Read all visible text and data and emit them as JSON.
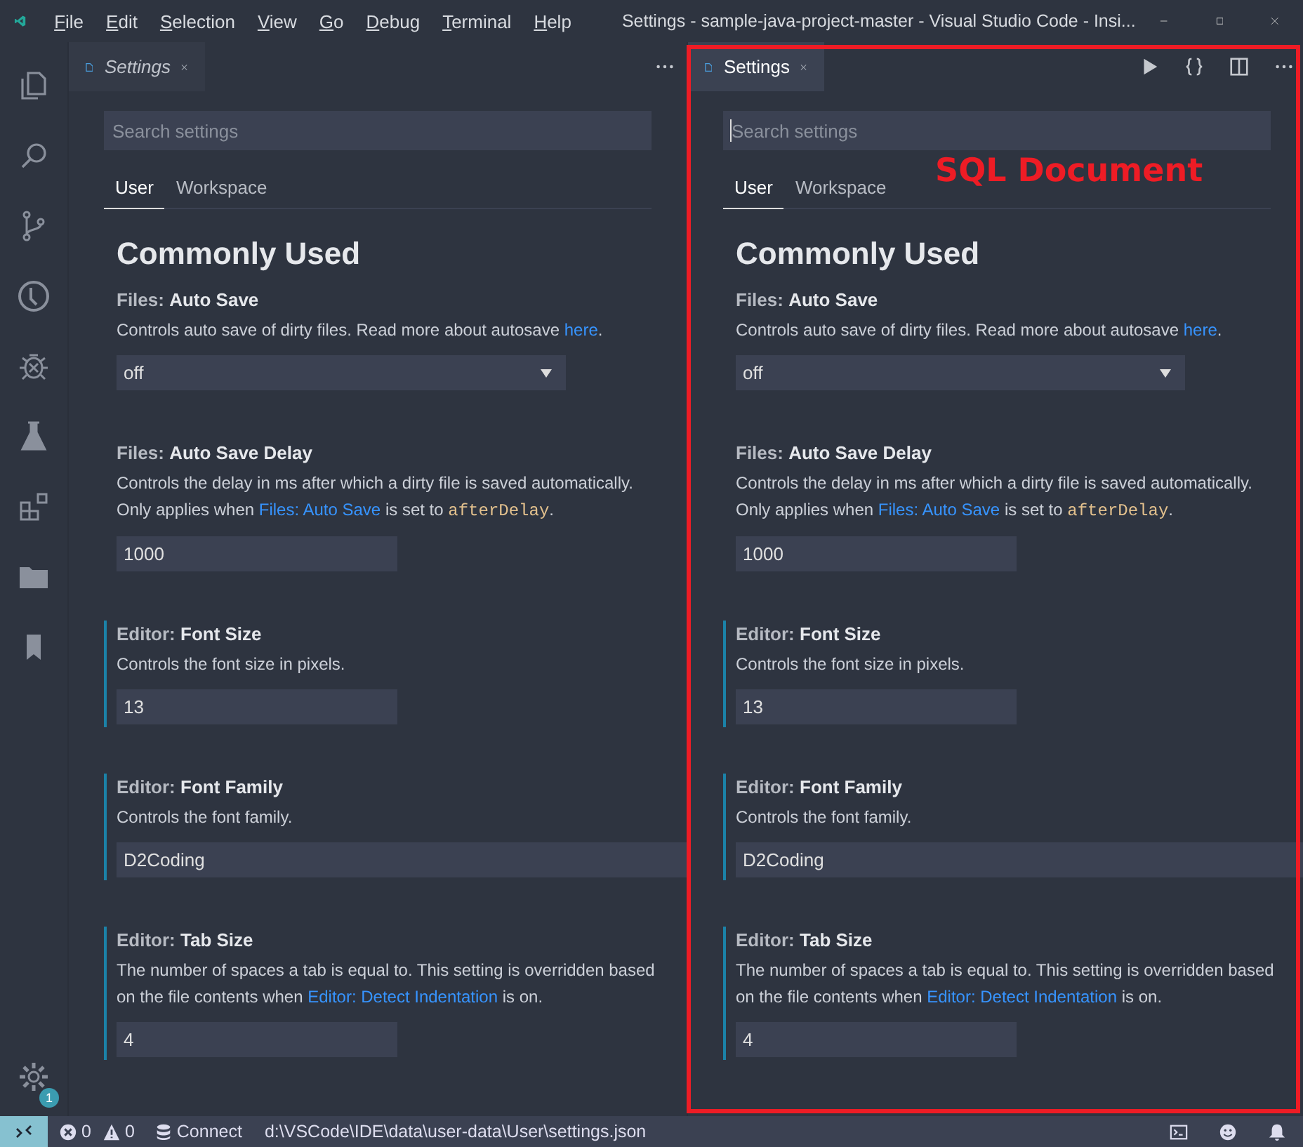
{
  "window": {
    "title": "Settings - sample-java-project-master - Visual Studio Code - Insi...",
    "menu": [
      "File",
      "Edit",
      "Selection",
      "View",
      "Go",
      "Debug",
      "Terminal",
      "Help"
    ]
  },
  "activity_bar": {
    "items": [
      {
        "kind": "files"
      },
      {
        "kind": "search"
      },
      {
        "kind": "branch"
      },
      {
        "kind": "history"
      },
      {
        "kind": "bug"
      },
      {
        "kind": "flask"
      },
      {
        "kind": "extensions"
      },
      {
        "kind": "folder"
      },
      {
        "kind": "bookmark"
      }
    ],
    "settings_badge": "1"
  },
  "editor_groups": [
    {
      "tab": {
        "label": "Settings",
        "preview": true,
        "selected": false
      },
      "actions": [
        {
          "kind": "more"
        }
      ],
      "search": {
        "placeholder": "Search settings",
        "focused": false
      },
      "scope_tabs": [
        {
          "label": "User",
          "selected": true
        },
        {
          "label": "Workspace",
          "selected": false
        }
      ],
      "heading": "Commonly Used",
      "settings": [
        {
          "title": "Files: **Auto Save**",
          "modified": false,
          "description": [
            {
              "kind": "plain",
              "text": "Controls auto save of dirty files. Read more about autosave "
            },
            {
              "kind": "link",
              "text": "here"
            },
            {
              "kind": "plain",
              "text": "."
            }
          ],
          "control": {
            "kind": "select",
            "value": "off"
          }
        },
        {
          "title": "Files: **Auto Save Delay**",
          "modified": false,
          "description": [
            {
              "kind": "plain",
              "text": "Controls the delay in ms after which a dirty file is saved automatically. Only applies when "
            },
            {
              "kind": "link",
              "text": "Files: Auto Save"
            },
            {
              "kind": "plain",
              "text": " is set to "
            },
            {
              "kind": "code",
              "text": "afterDelay"
            },
            {
              "kind": "plain",
              "text": "."
            }
          ],
          "control": {
            "kind": "number",
            "value": "1000"
          }
        },
        {
          "title": "Editor: **Font Size**",
          "modified": true,
          "description": [
            {
              "kind": "plain",
              "text": "Controls the font size in pixels."
            }
          ],
          "control": {
            "kind": "number",
            "value": "13"
          }
        },
        {
          "title": "Editor: **Font Family**",
          "modified": true,
          "description": [
            {
              "kind": "plain",
              "text": "Controls the font family."
            }
          ],
          "control": {
            "kind": "text",
            "value": "D2Coding"
          }
        },
        {
          "title": "Editor: **Tab Size**",
          "modified": true,
          "description": [
            {
              "kind": "plain",
              "text": "The number of spaces a tab is equal to. This setting is overridden based on the file contents when "
            },
            {
              "kind": "link",
              "text": "Editor: Detect Indentation"
            },
            {
              "kind": "plain",
              "text": " is on."
            }
          ],
          "control": {
            "kind": "number",
            "value": "4"
          }
        }
      ]
    },
    {
      "tab": {
        "label": "Settings",
        "preview": false,
        "selected": true
      },
      "actions": [
        {
          "kind": "run"
        },
        {
          "kind": "braces"
        },
        {
          "kind": "split"
        },
        {
          "kind": "more"
        }
      ],
      "search": {
        "placeholder": "Search settings",
        "focused": true
      },
      "scope_tabs": [
        {
          "label": "User",
          "selected": true
        },
        {
          "label": "Workspace",
          "selected": false
        }
      ],
      "heading": "Commonly Used",
      "settings": [
        {
          "title": "Files: **Auto Save**",
          "modified": false,
          "description": [
            {
              "kind": "plain",
              "text": "Controls auto save of dirty files. Read more about autosave "
            },
            {
              "kind": "link",
              "text": "here"
            },
            {
              "kind": "plain",
              "text": "."
            }
          ],
          "control": {
            "kind": "select",
            "value": "off"
          }
        },
        {
          "title": "Files: **Auto Save Delay**",
          "modified": false,
          "description": [
            {
              "kind": "plain",
              "text": "Controls the delay in ms after which a dirty file is saved automatically. Only applies when "
            },
            {
              "kind": "link",
              "text": "Files: Auto Save"
            },
            {
              "kind": "plain",
              "text": " is set to "
            },
            {
              "kind": "code",
              "text": "afterDelay"
            },
            {
              "kind": "plain",
              "text": "."
            }
          ],
          "control": {
            "kind": "number",
            "value": "1000"
          }
        },
        {
          "title": "Editor: **Font Size**",
          "modified": true,
          "description": [
            {
              "kind": "plain",
              "text": "Controls the font size in pixels."
            }
          ],
          "control": {
            "kind": "number",
            "value": "13"
          }
        },
        {
          "title": "Editor: **Font Family**",
          "modified": true,
          "description": [
            {
              "kind": "plain",
              "text": "Controls the font family."
            }
          ],
          "control": {
            "kind": "text",
            "value": "D2Coding"
          }
        },
        {
          "title": "Editor: **Tab Size**",
          "modified": true,
          "description": [
            {
              "kind": "plain",
              "text": "The number of spaces a tab is equal to. This setting is overridden based on the file contents when "
            },
            {
              "kind": "link",
              "text": "Editor: Detect Indentation"
            },
            {
              "kind": "plain",
              "text": " is on."
            }
          ],
          "control": {
            "kind": "number",
            "value": "4"
          }
        }
      ]
    }
  ],
  "annotation": {
    "label": "SQL Document"
  },
  "status_bar": {
    "errors": "0",
    "warnings": "0",
    "connect": "Connect",
    "path": "d:\\VSCode\\IDE\\data\\user-data\\User\\settings.json"
  }
}
